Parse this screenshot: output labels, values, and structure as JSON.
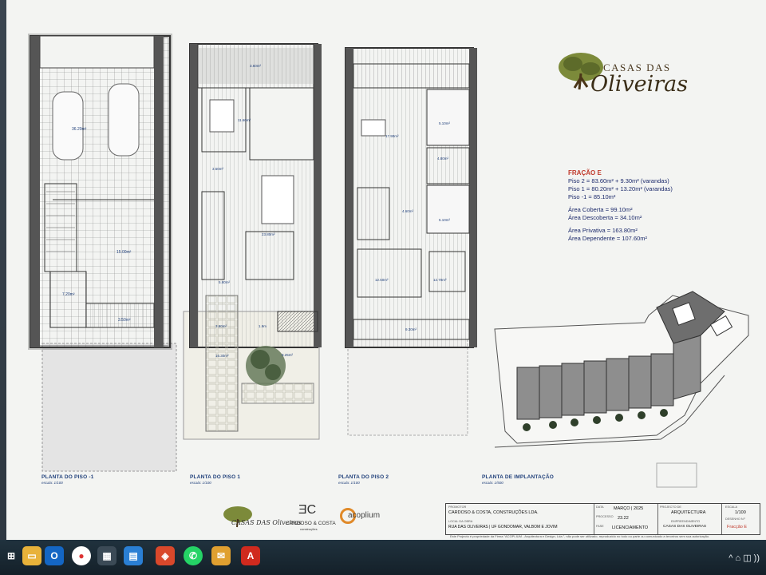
{
  "brand": {
    "top": "CASAS DAS",
    "script": "Oliveiras"
  },
  "plans": {
    "p1": {
      "title": "PLANTA DO PISO -1",
      "scale": "escala: 1/100"
    },
    "p2": {
      "title": "PLANTA DO PISO 1",
      "scale": "escala: 1/100"
    },
    "p3": {
      "title": "PLANTA DO PISO 2",
      "scale": "escala: 1/100"
    },
    "p4": {
      "title": "PLANTA DE IMPLANTAÇÃO",
      "scale": "escala: 1/500"
    }
  },
  "room_labels": {
    "garage": "36.20m²",
    "r3": "15.00m²",
    "r4": "7.20m²",
    "r5": "3.50m²",
    "varanda1": "3.60m²",
    "sala": "23.80m²",
    "cozinha": "11.60m²",
    "wc1": "3.50m²",
    "entrada": "5.80m²",
    "p6": "3.90m²",
    "p7": "1.9m",
    "p2": "16.30m²",
    "jardim": "9.25m²",
    "q1": "17.90m²",
    "q2": "12.50m²",
    "q3": "12.70m²",
    "wc2": "5.10m²",
    "wc3": "5.10m²",
    "hall": "4.80m²",
    "corr": "4.60m²",
    "var2": "9.30m²"
  },
  "info": {
    "title": "FRAÇÃO E",
    "lines1": [
      "Piso 2 = 83.60m² + 9.30m² (varandas)",
      "Piso 1 = 80.20m² + 13.20m² (varandas)",
      "Piso -1 = 85.10m²"
    ],
    "lines2": [
      "Área Coberta = 99.10m²",
      "Área Descoberta = 34.10m²"
    ],
    "lines3": [
      "Área Privativa = 163.80m²",
      "Área Dependente = 107.60m²"
    ]
  },
  "footer_logos": {
    "casas": "CASAS DAS Oliveiras",
    "cardoso": "CARDOSO & COSTA",
    "cardoso_sub": "construções",
    "acoplium": "acoplium"
  },
  "title_block": {
    "promotor_label": "PROMOTOR",
    "promotor": "CARDOSO & COSTA, CONSTRUÇÕES LDA.",
    "obra_label": "LOCAL DA OBRA",
    "obra": "RUA DAS OLIVEIRAS | UF GONDOMAR, VALBOM E JOVIM",
    "data_label": "DATA",
    "data": "MARÇO | 2025",
    "processo_label": "PROCESSO",
    "processo": "23.22",
    "fase_label": "FASE",
    "fase": "LICENCIAMENTO",
    "projeto_label": "PROJECTO DE",
    "projeto": "ARQUITECTURA",
    "emp_label": "EMPREENDIMENTO",
    "emp": "CASAS DAS OLIVEIRAS",
    "escala_label": "ESCALA",
    "escala": "1/100",
    "desenho_label": "DESENHO N.º",
    "desenho": "Fracção E",
    "disclaimer": "Este Projecto é propriedade da Firma \"ACOPLIUM - Arquitectura e Design, Lda.\", não pode ser utilizado, reproduzido no todo ou parte ou comunicado a terceiros sem sua autorização."
  },
  "taskbar": {
    "apps": [
      "start-icon",
      "explorer-icon",
      "outlook-icon",
      "chrome-icon",
      "calculator-icon",
      "files-icon",
      "office-icon",
      "whatsapp-icon",
      "mail-icon",
      "pdf-icon"
    ],
    "tray": "^ ⌂ ◫ ))"
  }
}
